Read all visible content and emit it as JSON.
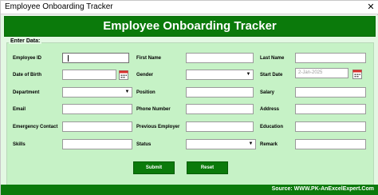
{
  "window": {
    "title": "Employee Onboarding Tracker",
    "close_glyph": "✕"
  },
  "header": {
    "title": "Employee Onboarding Tracker"
  },
  "form": {
    "legend": "Enter Data:",
    "labels": {
      "employee_id": "Employee ID",
      "first_name": "First Name",
      "last_name": "Last Name",
      "date_of_birth": "Date of Birth",
      "gender": "Gender",
      "start_date": "Start Date",
      "department": "Department",
      "position": "Position",
      "salary": "Salary",
      "email": "Email",
      "phone_number": "Phone Number",
      "address": "Address",
      "emergency_contact": "Emergency Contact",
      "previous_employer": "Previous Employer",
      "education": "Education",
      "skills": "Skills",
      "status": "Status",
      "remark": "Remark"
    },
    "values": {
      "start_date_placeholder": "2-Jan-2025"
    }
  },
  "buttons": {
    "submit": "Submit",
    "reset": "Reset"
  },
  "footer": {
    "source": "Source: WWW.PK-AnExcelExpert.Com"
  },
  "colors": {
    "brand_green": "#0b7a0b",
    "panel_green": "#c6f2c6"
  }
}
